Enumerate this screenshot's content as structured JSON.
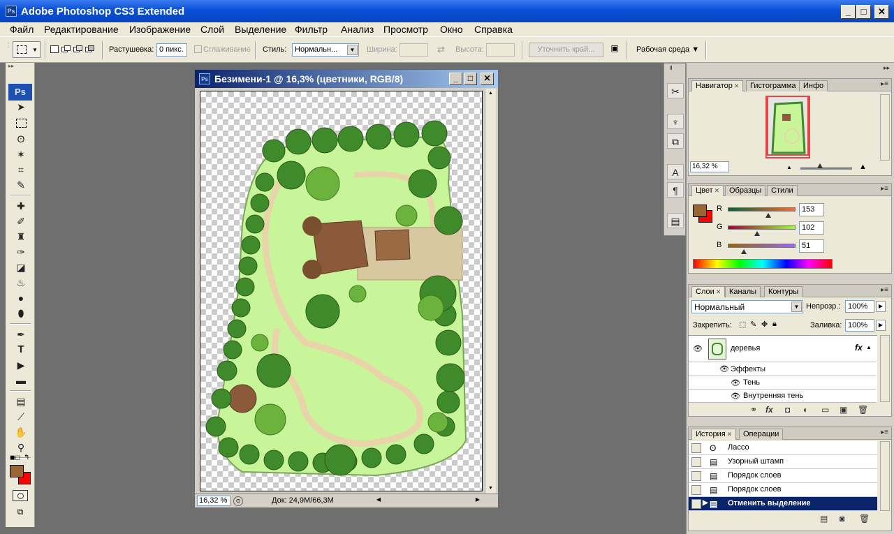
{
  "window": {
    "app_icon": "Ps",
    "title": "Adobe Photoshop CS3 Extended",
    "minimize": "_",
    "maximize": "□",
    "close": "✕"
  },
  "menu": [
    "Файл",
    "Редактирование",
    "Изображение",
    "Слой",
    "Выделение",
    "Фильтр",
    "Анализ",
    "Просмотр",
    "Окно",
    "Справка"
  ],
  "options": {
    "feather_label": "Растушевка:",
    "feather_value": "0 пикс.",
    "antialias_label": "Сглаживание",
    "style_label": "Стиль:",
    "style_value": "Нормальн...",
    "width_label": "Ширина:",
    "height_label": "Высота:",
    "refine_edge": "Уточнить край...",
    "workspace": "Рабочая среда ▼"
  },
  "toolbox": {
    "badge": "Ps",
    "text_tool_glyph": "T"
  },
  "document": {
    "icon": "Ps",
    "title": "Безимени-1 @ 16,3% (цветники, RGB/8)",
    "zoom": "16,32 %",
    "doc_info": "Док: 24,9M/66,3M"
  },
  "navigator": {
    "tabs": [
      "Навигатор",
      "Гистограмма",
      "Инфо"
    ],
    "zoom": "16,32 %"
  },
  "color": {
    "tabs": [
      "Цвет",
      "Образцы",
      "Стили"
    ],
    "foreground": "#996633",
    "background": "#ff0000",
    "channels": [
      {
        "label": "R",
        "value": "153"
      },
      {
        "label": "G",
        "value": "102"
      },
      {
        "label": "B",
        "value": "51"
      }
    ]
  },
  "layers": {
    "tabs": [
      "Слои",
      "Каналы",
      "Контуры"
    ],
    "blend_mode": "Нормальный",
    "opacity_label": "Непрозр.:",
    "opacity": "100%",
    "lock_label": "Закрепить:",
    "fill_label": "Заливка:",
    "fill": "100%",
    "layer_name": "деревья",
    "fx_badge": "fx",
    "effects_label": "Эффекты",
    "effects": [
      "Тень",
      "Внутренняя тень"
    ]
  },
  "history": {
    "tabs": [
      "История",
      "Операции"
    ],
    "items": [
      "Лассо",
      "Узорный штамп",
      "Порядок слоев",
      "Порядок слоев",
      "Отменить выделение"
    ]
  },
  "colors": {
    "titlebar": "#0a4fd6",
    "selection": "#0a246a",
    "lawn": "#c8f59a",
    "roof": "#8a5a3a"
  }
}
